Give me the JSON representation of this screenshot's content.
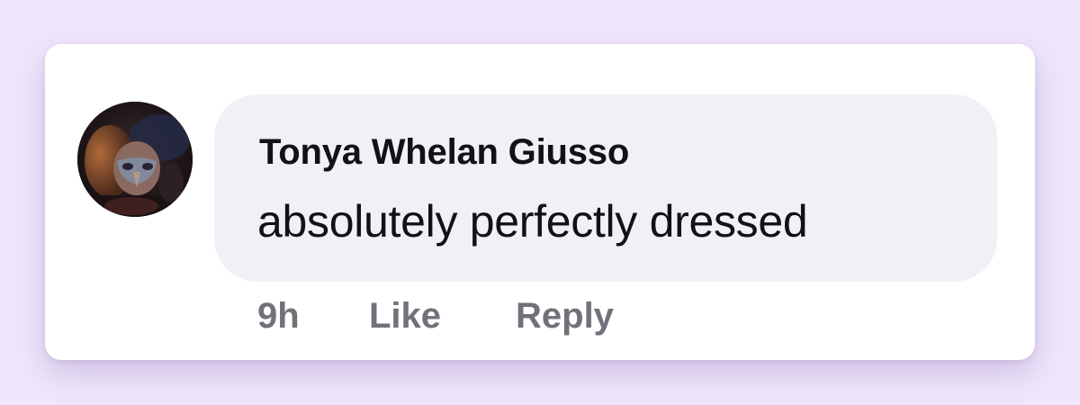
{
  "comment": {
    "author": "Tonya Whelan Giusso",
    "text": "absolutely perfectly dressed",
    "timestamp": "9h",
    "actions": {
      "like_label": "Like",
      "reply_label": "Reply"
    }
  },
  "colors": {
    "page_background": "#efe6fb",
    "card_background": "#ffffff",
    "bubble_background": "#f0f1f6",
    "text_primary": "#121214",
    "text_secondary": "#707279"
  }
}
